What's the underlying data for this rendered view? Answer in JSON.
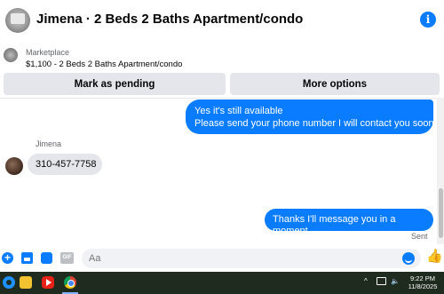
{
  "header": {
    "title": "Jimena · 2 Beds 2 Baths Apartment/condo",
    "info_icon": "info-icon"
  },
  "marketplace": {
    "label": "Marketplace",
    "listing": "$1,100 - 2 Beds 2 Baths Apartment/condo"
  },
  "actions": {
    "mark_pending": "Mark as pending",
    "more_options": "More options"
  },
  "messages": [
    {
      "direction": "outgoing",
      "lines": [
        "Yes it's still available",
        "Please send your phone number I will contact you soon."
      ]
    },
    {
      "direction": "incoming",
      "sender": "Jimena",
      "text": "310-457-7758"
    },
    {
      "direction": "outgoing",
      "text": "Thanks I'll message you in a moment",
      "status": "Sent"
    }
  ],
  "composer": {
    "placeholder": "Aa",
    "gif_label": "GIF",
    "icons": [
      "plus-icon",
      "photo-icon",
      "sticker-icon",
      "gif-icon",
      "emoji-icon",
      "like-icon"
    ]
  },
  "taskbar": {
    "icons": [
      "start-icon",
      "folder-icon",
      "youtube-icon",
      "chrome-icon"
    ],
    "time": "9:22 PM",
    "date": "11/8/2025"
  },
  "colors": {
    "accent": "#0a7cff",
    "bubble_in": "#e4e6eb",
    "button_bg": "#e4e6eb",
    "taskbar": "#1f2b1f"
  }
}
